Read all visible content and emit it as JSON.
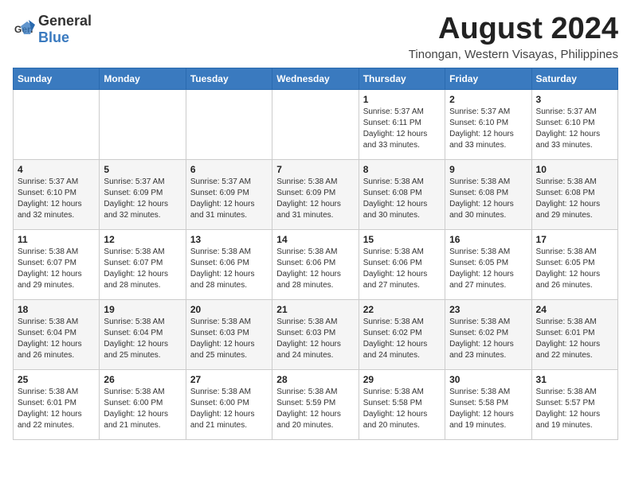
{
  "logo": {
    "text_general": "General",
    "text_blue": "Blue"
  },
  "title": {
    "month_year": "August 2024",
    "location": "Tinongan, Western Visayas, Philippines"
  },
  "weekdays": [
    "Sunday",
    "Monday",
    "Tuesday",
    "Wednesday",
    "Thursday",
    "Friday",
    "Saturday"
  ],
  "weeks": [
    [
      {
        "day": "",
        "info": ""
      },
      {
        "day": "",
        "info": ""
      },
      {
        "day": "",
        "info": ""
      },
      {
        "day": "",
        "info": ""
      },
      {
        "day": "1",
        "info": "Sunrise: 5:37 AM\nSunset: 6:11 PM\nDaylight: 12 hours\nand 33 minutes."
      },
      {
        "day": "2",
        "info": "Sunrise: 5:37 AM\nSunset: 6:10 PM\nDaylight: 12 hours\nand 33 minutes."
      },
      {
        "day": "3",
        "info": "Sunrise: 5:37 AM\nSunset: 6:10 PM\nDaylight: 12 hours\nand 33 minutes."
      }
    ],
    [
      {
        "day": "4",
        "info": "Sunrise: 5:37 AM\nSunset: 6:10 PM\nDaylight: 12 hours\nand 32 minutes."
      },
      {
        "day": "5",
        "info": "Sunrise: 5:37 AM\nSunset: 6:09 PM\nDaylight: 12 hours\nand 32 minutes."
      },
      {
        "day": "6",
        "info": "Sunrise: 5:37 AM\nSunset: 6:09 PM\nDaylight: 12 hours\nand 31 minutes."
      },
      {
        "day": "7",
        "info": "Sunrise: 5:38 AM\nSunset: 6:09 PM\nDaylight: 12 hours\nand 31 minutes."
      },
      {
        "day": "8",
        "info": "Sunrise: 5:38 AM\nSunset: 6:08 PM\nDaylight: 12 hours\nand 30 minutes."
      },
      {
        "day": "9",
        "info": "Sunrise: 5:38 AM\nSunset: 6:08 PM\nDaylight: 12 hours\nand 30 minutes."
      },
      {
        "day": "10",
        "info": "Sunrise: 5:38 AM\nSunset: 6:08 PM\nDaylight: 12 hours\nand 29 minutes."
      }
    ],
    [
      {
        "day": "11",
        "info": "Sunrise: 5:38 AM\nSunset: 6:07 PM\nDaylight: 12 hours\nand 29 minutes."
      },
      {
        "day": "12",
        "info": "Sunrise: 5:38 AM\nSunset: 6:07 PM\nDaylight: 12 hours\nand 28 minutes."
      },
      {
        "day": "13",
        "info": "Sunrise: 5:38 AM\nSunset: 6:06 PM\nDaylight: 12 hours\nand 28 minutes."
      },
      {
        "day": "14",
        "info": "Sunrise: 5:38 AM\nSunset: 6:06 PM\nDaylight: 12 hours\nand 28 minutes."
      },
      {
        "day": "15",
        "info": "Sunrise: 5:38 AM\nSunset: 6:06 PM\nDaylight: 12 hours\nand 27 minutes."
      },
      {
        "day": "16",
        "info": "Sunrise: 5:38 AM\nSunset: 6:05 PM\nDaylight: 12 hours\nand 27 minutes."
      },
      {
        "day": "17",
        "info": "Sunrise: 5:38 AM\nSunset: 6:05 PM\nDaylight: 12 hours\nand 26 minutes."
      }
    ],
    [
      {
        "day": "18",
        "info": "Sunrise: 5:38 AM\nSunset: 6:04 PM\nDaylight: 12 hours\nand 26 minutes."
      },
      {
        "day": "19",
        "info": "Sunrise: 5:38 AM\nSunset: 6:04 PM\nDaylight: 12 hours\nand 25 minutes."
      },
      {
        "day": "20",
        "info": "Sunrise: 5:38 AM\nSunset: 6:03 PM\nDaylight: 12 hours\nand 25 minutes."
      },
      {
        "day": "21",
        "info": "Sunrise: 5:38 AM\nSunset: 6:03 PM\nDaylight: 12 hours\nand 24 minutes."
      },
      {
        "day": "22",
        "info": "Sunrise: 5:38 AM\nSunset: 6:02 PM\nDaylight: 12 hours\nand 24 minutes."
      },
      {
        "day": "23",
        "info": "Sunrise: 5:38 AM\nSunset: 6:02 PM\nDaylight: 12 hours\nand 23 minutes."
      },
      {
        "day": "24",
        "info": "Sunrise: 5:38 AM\nSunset: 6:01 PM\nDaylight: 12 hours\nand 22 minutes."
      }
    ],
    [
      {
        "day": "25",
        "info": "Sunrise: 5:38 AM\nSunset: 6:01 PM\nDaylight: 12 hours\nand 22 minutes."
      },
      {
        "day": "26",
        "info": "Sunrise: 5:38 AM\nSunset: 6:00 PM\nDaylight: 12 hours\nand 21 minutes."
      },
      {
        "day": "27",
        "info": "Sunrise: 5:38 AM\nSunset: 6:00 PM\nDaylight: 12 hours\nand 21 minutes."
      },
      {
        "day": "28",
        "info": "Sunrise: 5:38 AM\nSunset: 5:59 PM\nDaylight: 12 hours\nand 20 minutes."
      },
      {
        "day": "29",
        "info": "Sunrise: 5:38 AM\nSunset: 5:58 PM\nDaylight: 12 hours\nand 20 minutes."
      },
      {
        "day": "30",
        "info": "Sunrise: 5:38 AM\nSunset: 5:58 PM\nDaylight: 12 hours\nand 19 minutes."
      },
      {
        "day": "31",
        "info": "Sunrise: 5:38 AM\nSunset: 5:57 PM\nDaylight: 12 hours\nand 19 minutes."
      }
    ]
  ]
}
